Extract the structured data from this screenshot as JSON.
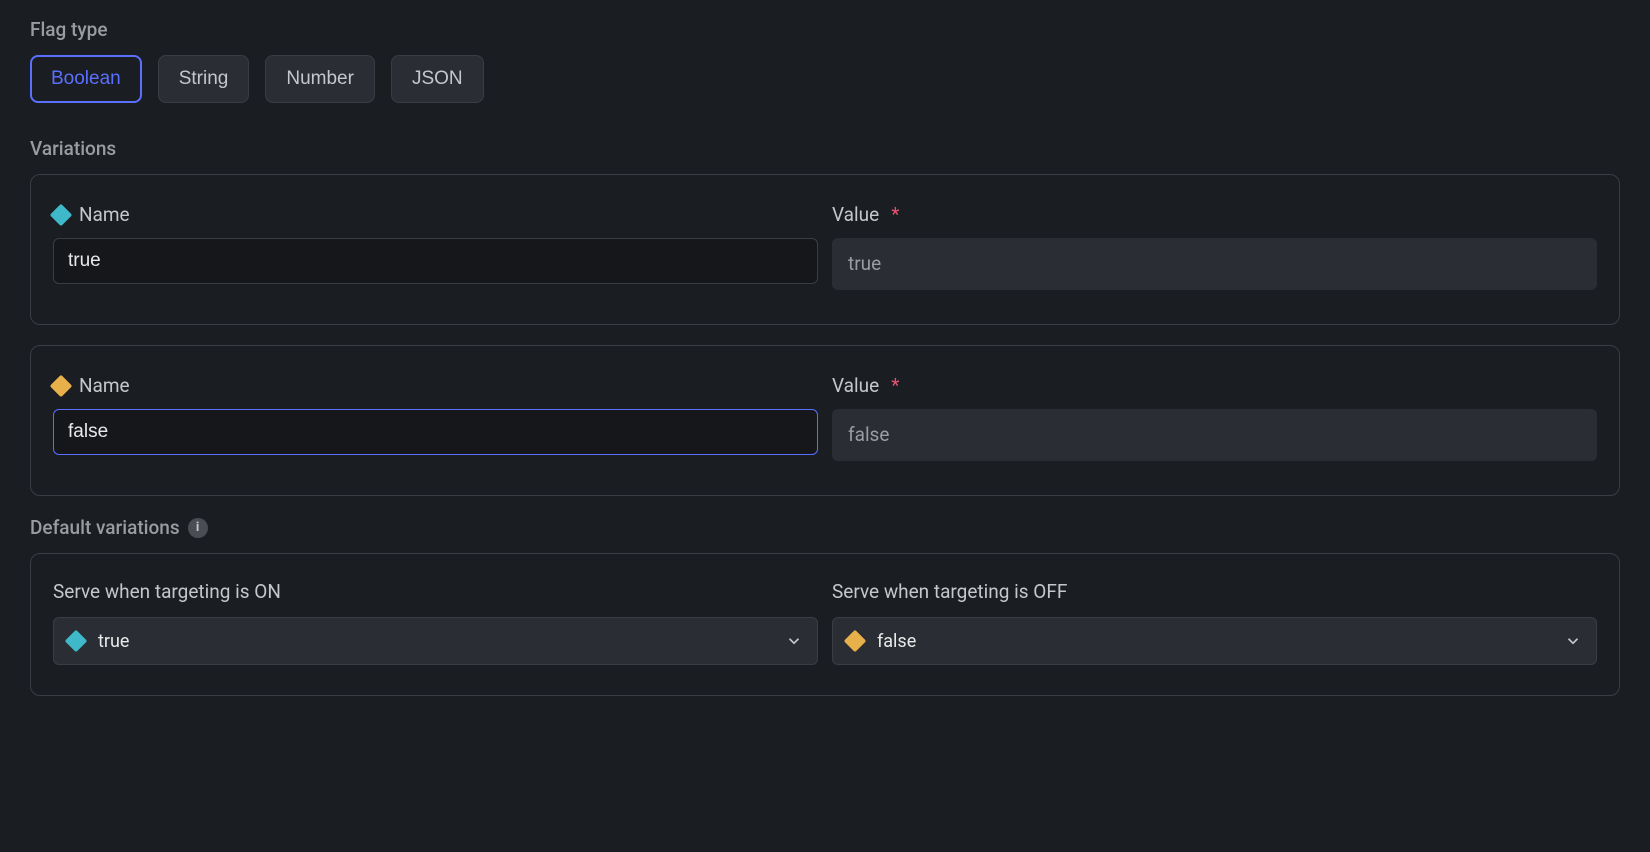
{
  "flag_type": {
    "label": "Flag type",
    "options": [
      "Boolean",
      "String",
      "Number",
      "JSON"
    ],
    "selected": "Boolean"
  },
  "variations": {
    "label": "Variations",
    "items": [
      {
        "icon_color": "blue",
        "name_label": "Name",
        "name_value": "true",
        "value_label": "Value",
        "value_required": "*",
        "value_value": "true",
        "focused": false
      },
      {
        "icon_color": "yellow",
        "name_label": "Name",
        "name_value": "false",
        "value_label": "Value",
        "value_required": "*",
        "value_value": "false",
        "focused": true
      }
    ]
  },
  "defaults": {
    "label": "Default variations",
    "info_glyph": "i",
    "on": {
      "label": "Serve when targeting is ON",
      "icon_color": "blue",
      "value": "true"
    },
    "off": {
      "label": "Serve when targeting is OFF",
      "icon_color": "yellow",
      "value": "false"
    }
  }
}
